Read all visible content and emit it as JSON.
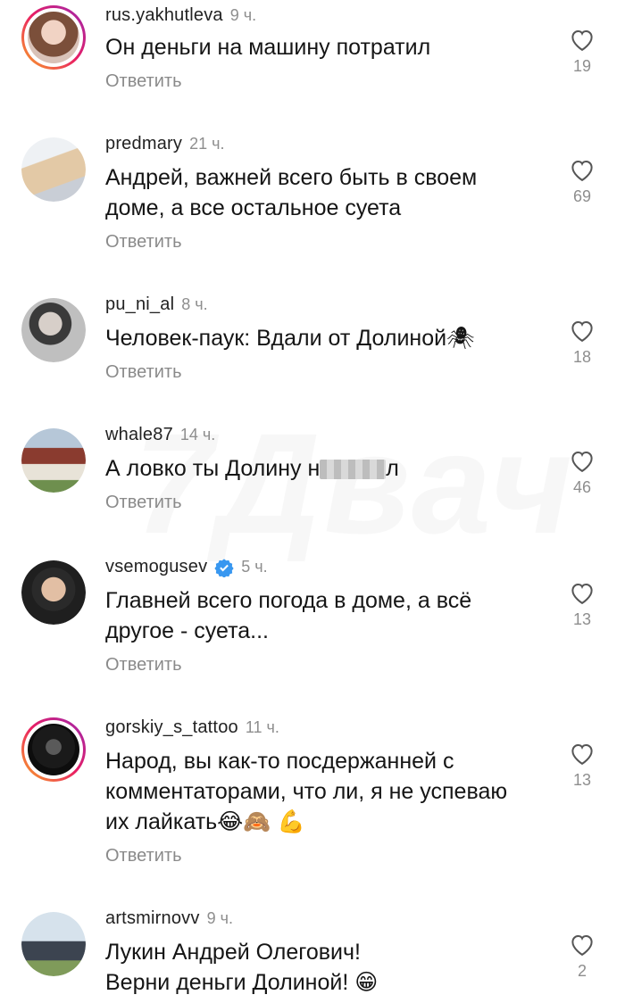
{
  "watermark": "7Двач",
  "reply_label": "Ответить",
  "comments": [
    {
      "username": "rus.yakhutleva",
      "time": "9 ч.",
      "text": [
        "Он деньги на машину потратил"
      ],
      "likes": "19",
      "story_ring": true
    },
    {
      "username": "predmary",
      "time": "21 ч.",
      "text": [
        "Андрей, важней всего быть в своем",
        "доме, а все остальное суета"
      ],
      "likes": "69",
      "story_ring": false
    },
    {
      "username": "pu_ni_al",
      "time": "8 ч.",
      "text": [
        "Человек-паук: Вдали от Долиной🕷"
      ],
      "likes": "18",
      "story_ring": false
    },
    {
      "username": "whale87",
      "time": "14 ч.",
      "text_before_blur": "А ловко ты Долину н",
      "text_after_blur": "л",
      "likes": "46",
      "story_ring": false
    },
    {
      "username": "vsemogusev",
      "time": "5 ч.",
      "verified": true,
      "text": [
        "Главней всего погода в доме, а всё",
        "другое - суета..."
      ],
      "likes": "13",
      "story_ring": false
    },
    {
      "username": "gorskiy_s_tattoo",
      "time": "11 ч.",
      "text": [
        "Народ, вы как-то посдержанней с",
        "комментаторами, что ли, я не успеваю",
        "их лайкать😂🙈 💪"
      ],
      "likes": "13",
      "story_ring": true
    },
    {
      "username": "artsmirnovv",
      "time": "9 ч.",
      "text": [
        "Лукин Андрей Олегович!",
        "Верни деньги Долиной! 😁"
      ],
      "likes": "2",
      "story_ring": false
    }
  ],
  "colors": {
    "secondary_text": "#8e8e8e",
    "verified_blue": "#3897f0"
  }
}
